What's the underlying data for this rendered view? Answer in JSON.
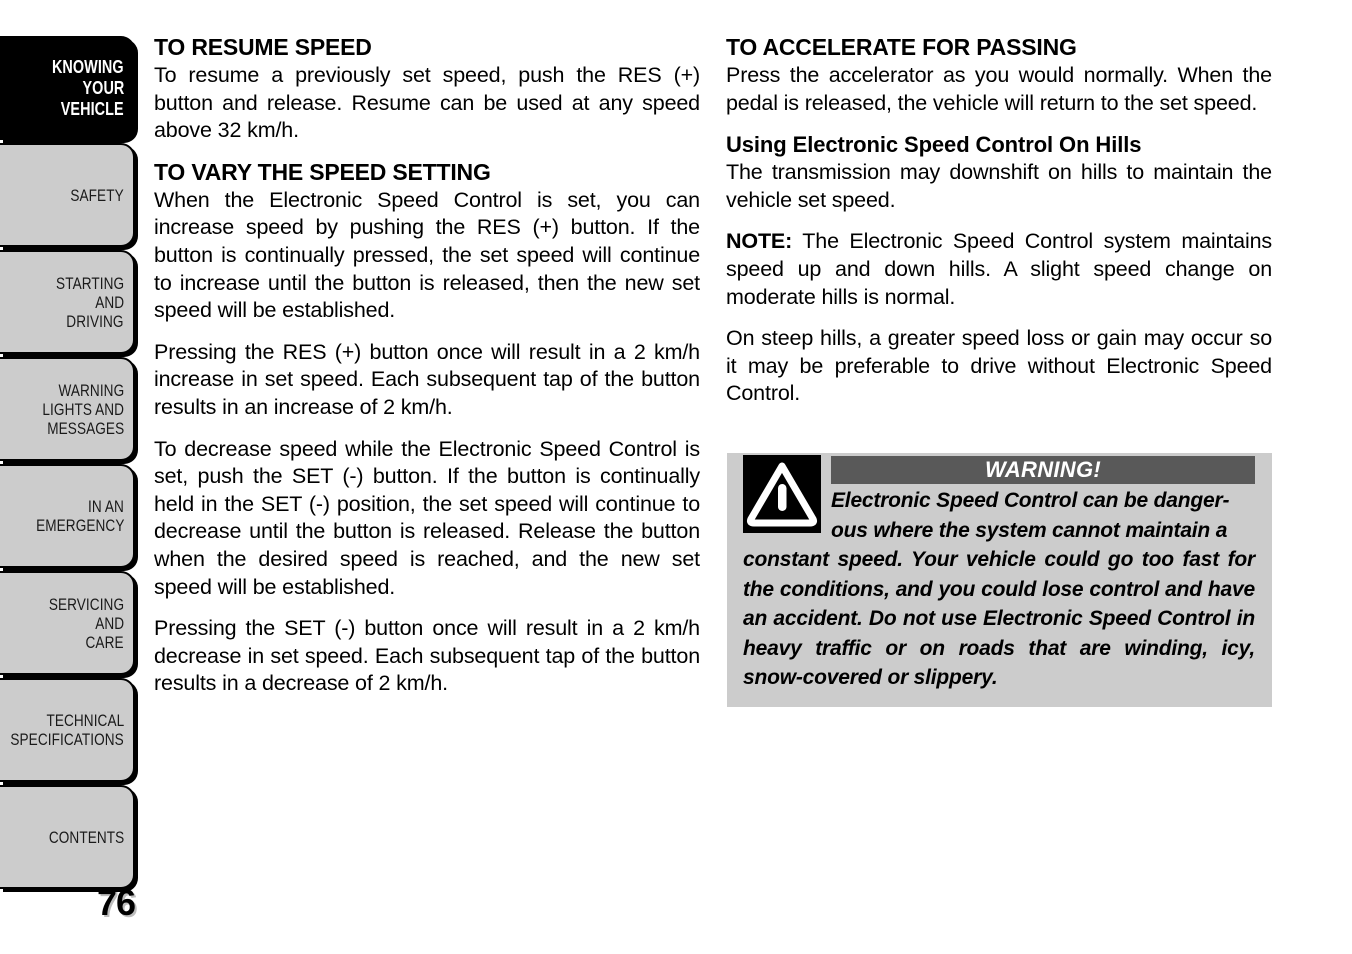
{
  "sidebar": {
    "tabs": [
      {
        "id": "knowing-your-vehicle",
        "current": true,
        "lines": [
          "KNOWING",
          "YOUR",
          "VEHICLE"
        ]
      },
      {
        "id": "safety",
        "current": false,
        "lines": [
          "SAFETY"
        ]
      },
      {
        "id": "starting-and-driving",
        "current": false,
        "lines": [
          "STARTING",
          "AND",
          "DRIVING"
        ]
      },
      {
        "id": "warning-lights-and-messages",
        "current": false,
        "lines": [
          "WARNING",
          "LIGHTS AND",
          "MESSAGES"
        ]
      },
      {
        "id": "in-an-emergency",
        "current": false,
        "lines": [
          "IN AN",
          "EMERGENCY"
        ]
      },
      {
        "id": "servicing-and-care",
        "current": false,
        "lines": [
          "SERVICING",
          "AND",
          "CARE"
        ]
      },
      {
        "id": "technical-specifications",
        "current": false,
        "lines": [
          "TECHNICAL",
          "SPECIFICATIONS"
        ]
      },
      {
        "id": "contents",
        "current": false,
        "lines": [
          "CONTENTS"
        ]
      }
    ]
  },
  "page_number": "76",
  "left_column": {
    "heading_1": "TO RESUME SPEED",
    "para_1": "To resume a previously set speed, push the RES (+) button and release. Resume can be used at any speed above 32 km/h.",
    "heading_2": "TO VARY THE SPEED SETTING",
    "para_2": "When the Electronic Speed Control is set, you can increase speed by pushing the RES (+) button. If the button is continually pressed, the set speed will continue to increase until the button is released, then the new set speed will be established.",
    "para_3": "Pressing the RES (+) button once will result in a 2 km/h increase in set speed. Each subsequent tap of the button results in an increase of 2 km/h.",
    "para_4": "To decrease speed while the Electronic Speed Control is set, push the SET (-) button. If the button is continually held in the SET (-) position, the set speed will continue to decrease until the button is released. Release the button when the desired speed is reached, and the new set speed will be established.",
    "para_5": "Pressing the SET (-) button once will result in a 2 km/h decrease in set speed. Each subsequent tap of the button results in a decrease of 2 km/h."
  },
  "right_column": {
    "heading_1": "TO ACCELERATE FOR PASSING",
    "para_1": "Press the accelerator as you would normally. When the pedal is released, the vehicle will return to the set speed.",
    "heading_2": "Using Electronic Speed Control On Hills",
    "para_2": "The transmission may downshift on hills to maintain the vehicle set speed.",
    "note_label": "NOTE:",
    "note_text": "  The Electronic Speed Control system maintains speed up and down hills. A slight speed change on moderate hills is normal.",
    "para_3": "On steep hills, a greater speed loss or gain may occur so it may be preferable to drive without Electronic Speed Control."
  },
  "warning_box": {
    "icon_name": "warning-triangle-icon",
    "title": "WARNING!",
    "text_head": "Electronic Speed Control can be danger-ous where the system cannot maintain a",
    "text_head_line_1": "Electronic Speed Control can be danger-",
    "text_head_line_2": "ous where the system cannot maintain a",
    "text_body": "constant speed. Your vehicle could go too fast for the conditions, and you could lose control and have an accident. Do not use Electronic Speed Control in heavy traffic or on roads that are winding, icy, snow-covered or slippery."
  },
  "colors": {
    "tab_gray": "#cccccc",
    "tab_active": "#000000",
    "warning_bar_gray": "#595959",
    "warning_bg_gray": "#cccccc",
    "text": "#000000"
  }
}
